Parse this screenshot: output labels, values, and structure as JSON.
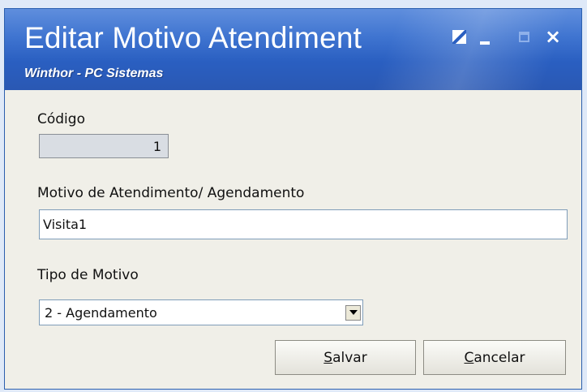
{
  "window": {
    "title": "Editar Motivo Atendiment",
    "subtitle": "Winthor - PC Sistemas",
    "controls": {
      "close_glyph": "×"
    }
  },
  "form": {
    "codigo": {
      "label": "Código",
      "value": "1"
    },
    "motivo": {
      "label": "Motivo de Atendimento/ Agendamento",
      "value": "Visita1"
    },
    "tipo": {
      "label": "Tipo de Motivo",
      "selected": "2 - Agendamento"
    }
  },
  "buttons": {
    "salvar": {
      "accel": "S",
      "rest": "alvar"
    },
    "cancelar": {
      "accel": "C",
      "rest": "ancelar"
    }
  },
  "colors": {
    "titlebar": "#2a5fc1",
    "window_bg": "#f0efe8"
  }
}
